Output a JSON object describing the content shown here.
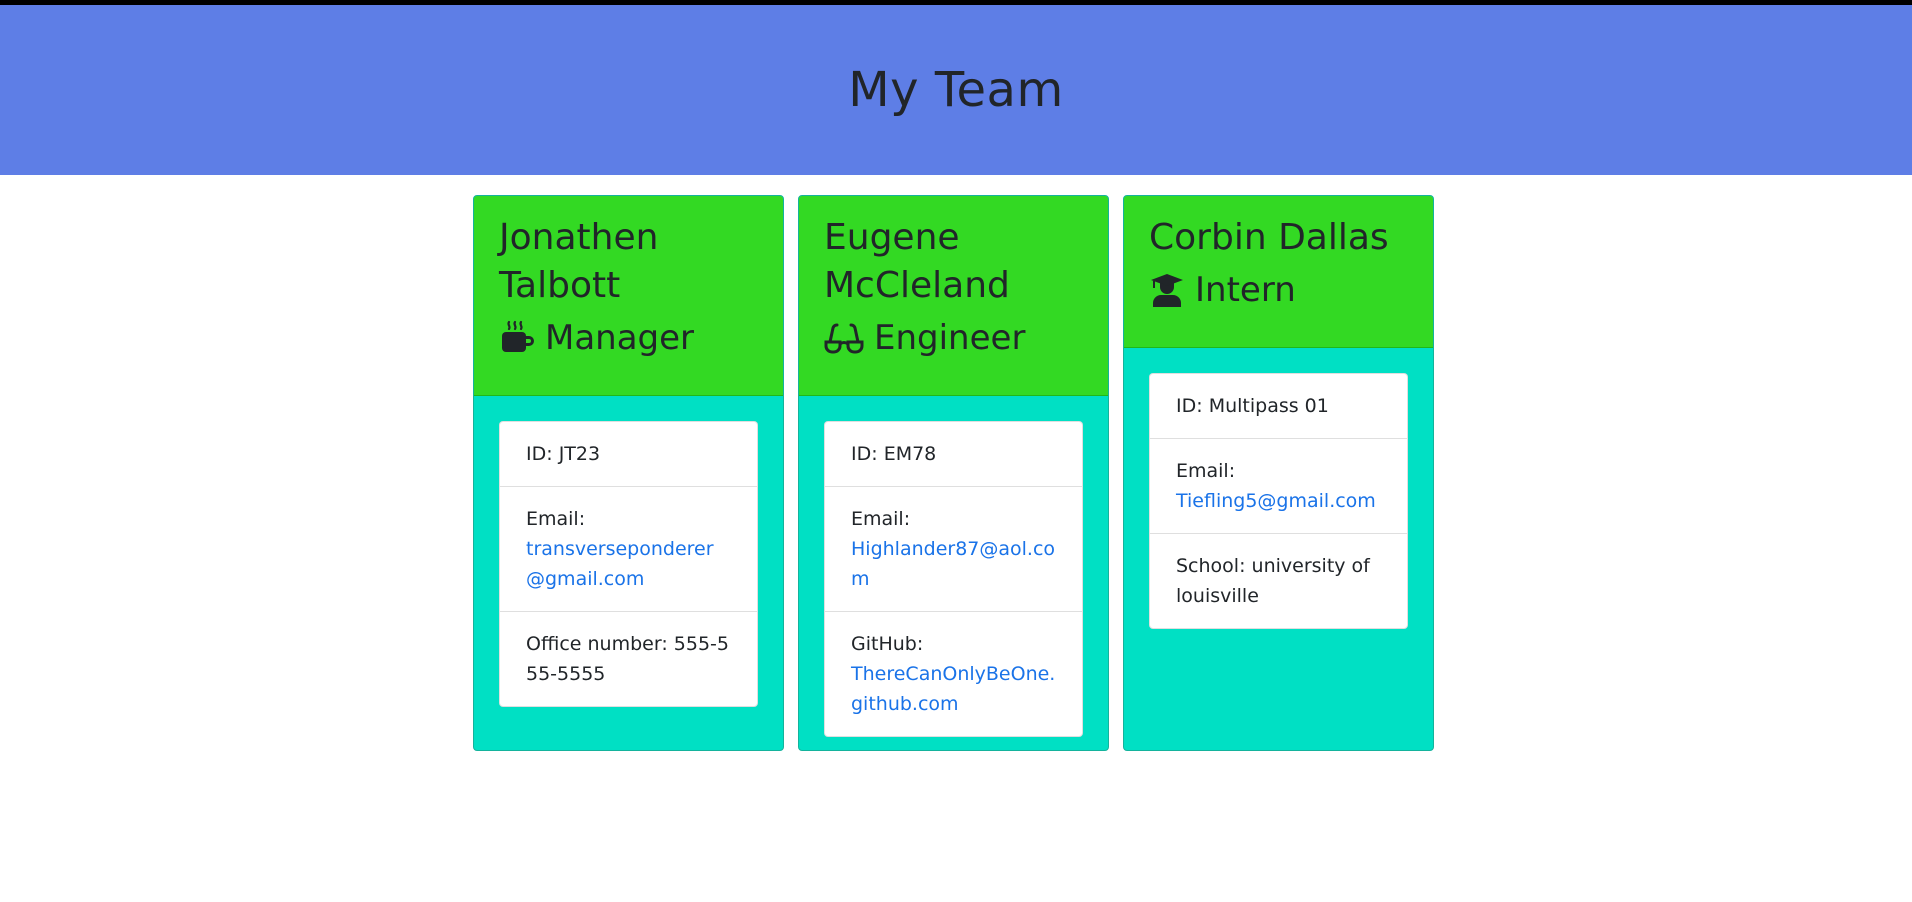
{
  "header": {
    "title": "My Team"
  },
  "colors": {
    "header_bg": "#5e7ee6",
    "card_header_bg": "#33d923",
    "card_body_bg": "#00e0c4",
    "link": "#1a73e8"
  },
  "employees": [
    {
      "name": "Jonathen Talbott",
      "role": "Manager",
      "role_icon": "mug-icon",
      "id_label": "ID:",
      "id": "JT23",
      "email_label": "Email:",
      "email": "transverseponderer@gmail.com",
      "extra_label": "Office number:",
      "extra_value": "555-555-5555"
    },
    {
      "name": "Eugene McCleland",
      "role": "Engineer",
      "role_icon": "glasses-icon",
      "id_label": "ID:",
      "id": "EM78",
      "email_label": "Email:",
      "email": "Highlander87@aol.com",
      "extra_label": "GitHub:",
      "extra_value": "ThereCanOnlyBeOne.github.com"
    },
    {
      "name": "Corbin Dallas",
      "role": "Intern",
      "role_icon": "graduate-icon",
      "id_label": "ID:",
      "id": "Multipass 01",
      "email_label": "Email:",
      "email": "Tiefling5@gmail.com",
      "extra_label": "School:",
      "extra_value": "university of louisville"
    }
  ]
}
